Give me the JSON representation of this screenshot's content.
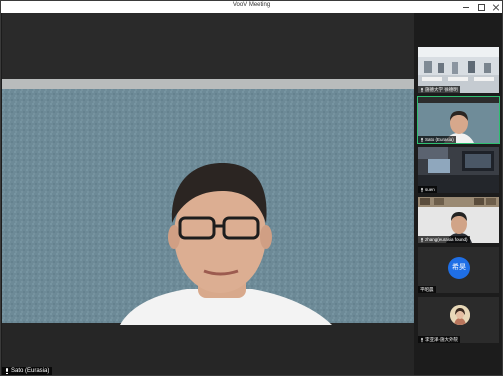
{
  "window": {
    "title": "VooV Meeting"
  },
  "main": {
    "speaker_name": "Sato (Eurasia)"
  },
  "participants": [
    {
      "label": "施德大学 徐德明"
    },
    {
      "label": "Sato (Eurasia)"
    },
    {
      "label": "suen"
    },
    {
      "label": "zhang(eurasia found)"
    },
    {
      "label": "平昭晨",
      "avatar_text": "希昊"
    },
    {
      "label": "李亚泽-施大外院"
    }
  ],
  "colors": {
    "active_border": "#2fbf71",
    "avatar_blue": "#1f6fe6"
  }
}
